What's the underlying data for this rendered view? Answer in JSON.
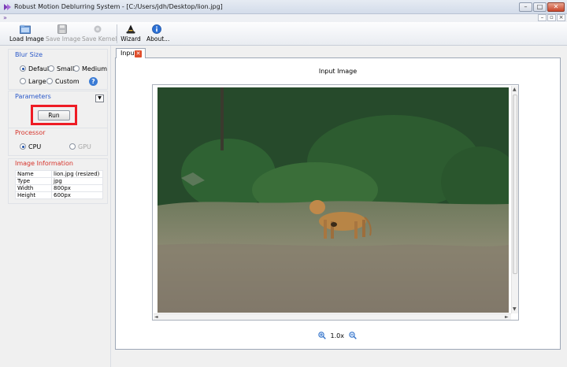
{
  "window": {
    "title": "Robust Motion Deblurring System - [C:/Users/jdh/Desktop/lion.jpg]",
    "buttons": {
      "minimize": "–",
      "maximize": "□",
      "close": "✕"
    }
  },
  "mdi": {
    "minimize": "–",
    "restore": "▫",
    "close": "×"
  },
  "toolbar": {
    "load_image": "Load Image",
    "save_image": "Save Image",
    "save_kernel": "Save Kernel",
    "wizard": "Wizard",
    "about": "About..."
  },
  "blur_size": {
    "heading": "Blur Size",
    "options": [
      "Default",
      "Small",
      "Medium",
      "Large",
      "Custom"
    ],
    "selected": "Default",
    "help": "?"
  },
  "parameters": {
    "heading": "Parameters",
    "dropdown": "▼",
    "run": "Run"
  },
  "processor": {
    "heading": "Processor",
    "options": [
      "CPU",
      "GPU"
    ],
    "selected": "CPU"
  },
  "image_info": {
    "heading": "Image Information",
    "rows": [
      [
        "Name",
        "lion.jpg (resized)"
      ],
      [
        "Type",
        "jpg"
      ],
      [
        "Width",
        "800px"
      ],
      [
        "Height",
        "600px"
      ]
    ]
  },
  "tab": {
    "label": "Input",
    "close": "✕"
  },
  "viewer": {
    "title": "Input Image",
    "zoom": "1.0x"
  },
  "colors": {
    "heading_blue": "#2a58c9",
    "heading_red": "#d6332a",
    "highlight": "#ee1c25"
  }
}
